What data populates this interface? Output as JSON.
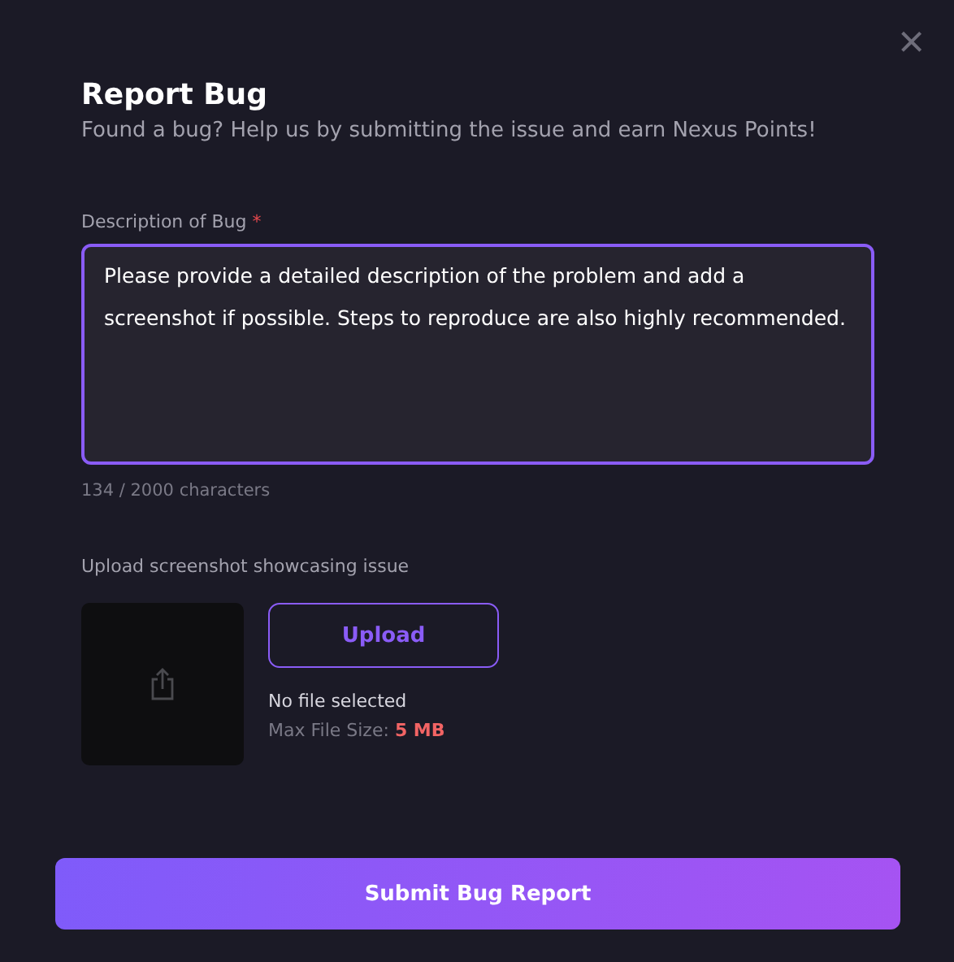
{
  "dialog": {
    "close": "×",
    "title": "Report Bug",
    "subtitle": "Found a bug? Help us by submitting the issue and earn Nexus Points!"
  },
  "description": {
    "label": "Description of Bug",
    "required_mark": "*",
    "value": "Please provide a detailed description of the problem and add a screenshot if possible. Steps to reproduce are also highly recommended.",
    "counter": "134 / 2000 characters"
  },
  "upload": {
    "label": "Upload screenshot showcasing issue",
    "button": "Upload",
    "status": "No file selected",
    "limit_label": "Max File Size:",
    "limit_value": "5 MB"
  },
  "submit": "Submit Bug Report"
}
